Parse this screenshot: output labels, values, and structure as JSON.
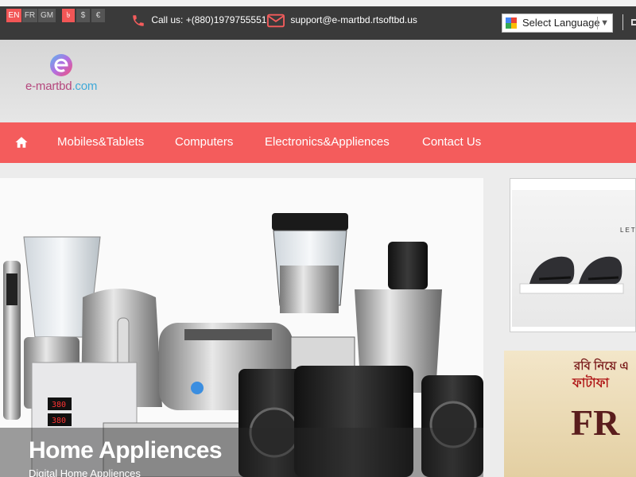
{
  "topbar": {
    "languages": [
      "EN",
      "FR",
      "GM"
    ],
    "currencies": [
      "৳",
      "$",
      "€"
    ],
    "phone": "Call us: +(880)1979755551",
    "email": "support@e-martbd.rtsoftbd.us",
    "language_select": "Select Language"
  },
  "header": {
    "logo_text_a": "e-martbd",
    "logo_text_b": ".com"
  },
  "nav": {
    "items": [
      "Mobiles&Tablets",
      "Computers",
      "Electronics&Appliences",
      "Contact Us"
    ]
  },
  "slider": {
    "title": "Home Appliences",
    "subtitle": "Digital Home Appliences"
  },
  "ads": {
    "ad1_text": "LET",
    "ad2_line1": "রবি নিয়ে এ",
    "ad2_line2": "ফাটাফা",
    "ad2_big": "FR"
  },
  "colors": {
    "accent": "#f45c5c",
    "topbar": "#3a3a3a"
  }
}
